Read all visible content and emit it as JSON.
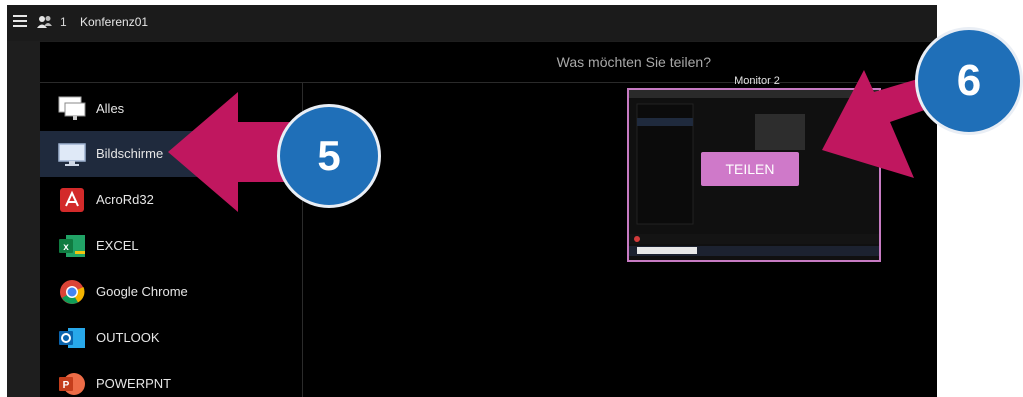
{
  "titlebar": {
    "participant_count": "1",
    "conference_name": "Konferenz01"
  },
  "dialog": {
    "title": "Was möchten Sie teilen?"
  },
  "sidebar": {
    "items": [
      {
        "label": "Alles",
        "icon": "monitor-icon"
      },
      {
        "label": "Bildschirme",
        "icon": "monitor-icon"
      },
      {
        "label": "AcroRd32",
        "icon": "acrobat-icon"
      },
      {
        "label": "EXCEL",
        "icon": "excel-icon"
      },
      {
        "label": "Google Chrome",
        "icon": "chrome-icon"
      },
      {
        "label": "OUTLOOK",
        "icon": "outlook-icon"
      },
      {
        "label": "POWERPNT",
        "icon": "powerpoint-icon"
      }
    ]
  },
  "preview": {
    "monitor_label": "Monitor 2",
    "share_button": "TEILEN"
  },
  "annotations": {
    "callout_5": "5",
    "callout_6": "6",
    "arrow_color": "#c0175f",
    "circle_color": "#1f6fb8"
  }
}
